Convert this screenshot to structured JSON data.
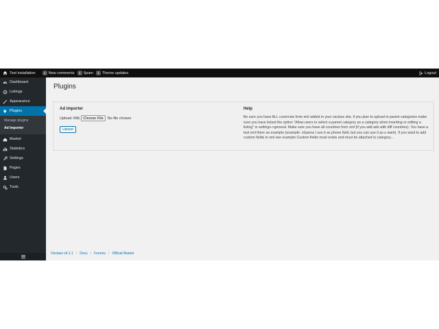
{
  "topbar": {
    "site_name": "Test installation",
    "items": [
      {
        "count": "1",
        "label": "New comments"
      },
      {
        "count": "1",
        "label": "Spam"
      },
      {
        "count": "1",
        "label": "Theme updates"
      }
    ],
    "logout_label": "Logout"
  },
  "sidebar": {
    "items": [
      {
        "label": "Dashboard",
        "icon": "dashboard-icon"
      },
      {
        "label": "Listings",
        "icon": "listings-icon"
      },
      {
        "label": "Appearance",
        "icon": "brush-icon"
      },
      {
        "label": "Plugins",
        "icon": "plug-icon"
      },
      {
        "label": "Market",
        "icon": "market-icon"
      },
      {
        "label": "Statistics",
        "icon": "chart-icon"
      },
      {
        "label": "Settings",
        "icon": "wrench-icon"
      },
      {
        "label": "Pages",
        "icon": "page-icon"
      },
      {
        "label": "Users",
        "icon": "users-icon"
      },
      {
        "label": "Tools",
        "icon": "tools-icon"
      }
    ],
    "submenu": [
      {
        "label": "Manage plugins"
      },
      {
        "label": "Ad Importer"
      }
    ]
  },
  "main": {
    "title": "Plugins",
    "importer": {
      "title": "Ad importer",
      "upload_label": "Upload XML",
      "choose_file_label": "Choose File",
      "no_file_text": "No file chosen",
      "upload_button": "Upload"
    },
    "help": {
      "title": "Help",
      "text": "Be sure you have ALL curencies from xml added in your osclass site, if you plan to upload in parent categories make sure you have ticked the option \"Allow users to select a parent category as a category when inserting or editing a listing\" in settings->general. Make sure you have all countries from xml (if you add ads with diff countries). You have a test xml there as example (example: cityarea I use it as phone field, but you can use it as u want). If you want to add custom fields in xml see example Custom fields must exists and must be attached to category..."
    }
  },
  "footer": {
    "version": "Osclass v4.1.1",
    "links": [
      "Docs",
      "Forums",
      "Official Market"
    ]
  },
  "colors": {
    "admin_bar": "#0f0f0f",
    "sidebar": "#23282d",
    "active": "#0073aa",
    "background": "#f1f1f1"
  }
}
